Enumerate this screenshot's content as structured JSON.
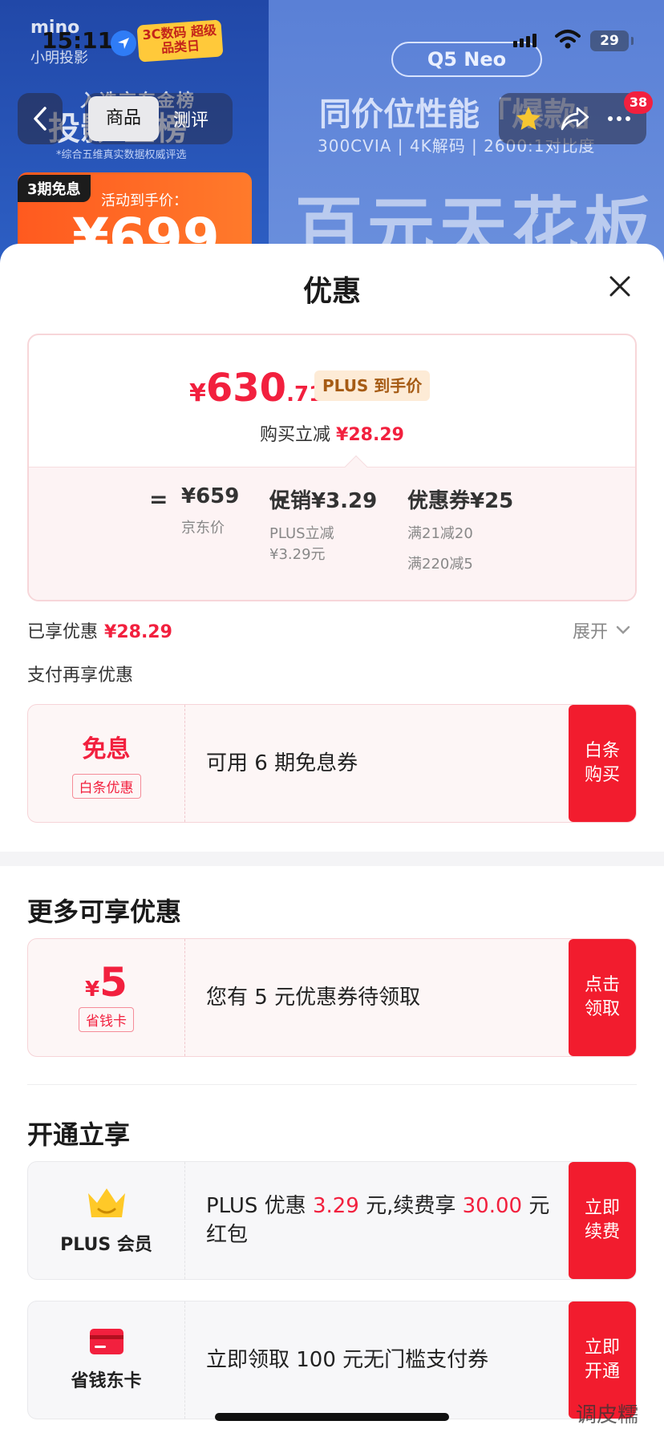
{
  "status_bar": {
    "time": "15:11",
    "battery": "29"
  },
  "background": {
    "brand": "mino",
    "brand_sub": "小明投影",
    "promo_tag": "3C数码 超级品类日",
    "rank_text": "入选京东金榜",
    "left_big": "投影 金榜",
    "left_small": "*综合五维真实数据权威评选",
    "installment_tag": "3期免息",
    "installment_label": "活动到手价：",
    "installment_price": "¥699",
    "model": "Q5 Neo",
    "headline": "同价位性能「爆款」",
    "specs": "300CVIA | 4K解码 | 2600:1对比度",
    "huge": "百元天花板"
  },
  "nav": {
    "tab_active": "商品",
    "tab_other": "测评",
    "badge": "38"
  },
  "sheet": {
    "title": "优惠",
    "price": {
      "currency": "¥",
      "integer": "630",
      "decimal": ".71",
      "plus_tag": "PLUS 到手价",
      "instant_cut_label": "购买立减",
      "instant_cut_value": "¥28.29"
    },
    "calc": {
      "equals": "=",
      "minus": "−",
      "jd_price": "¥659",
      "jd_price_label": "京东价",
      "promo": "促销¥3.29",
      "promo_sub1": "PLUS立减",
      "promo_sub2": "¥3.29元",
      "coupon": "优惠券¥25",
      "coupon_sub1": "满21减20",
      "coupon_sub2": "满220减5"
    },
    "enjoyed_label": "已享优惠",
    "enjoyed_value": "¥28.29",
    "expand_label": "展开",
    "pay_more_label": "支付再享优惠",
    "baitiao": {
      "title": "免息",
      "tag": "白条优惠",
      "text": "可用 6 期免息券",
      "button": "白条\n购买"
    },
    "more_section_title": "更多可享优惠",
    "saving_card": {
      "currency": "¥",
      "amount": "5",
      "tag": "省钱卡",
      "text": "您有 5 元优惠券待领取",
      "button": "点击\n领取"
    },
    "open_section_title": "开通立享",
    "plus": {
      "label": "PLUS 会员",
      "text_a": "PLUS 优惠 ",
      "text_b": "3.29",
      "text_c": " 元,续费享 ",
      "text_d": "30.00",
      "text_e": " 元红包",
      "button": "立即\n续费"
    },
    "jd_card": {
      "label": "省钱东卡",
      "text": "立即领取 100 元无门槛支付券",
      "button": "立即\n开通"
    },
    "watermark": "调皮糯"
  },
  "colors": {
    "accent_red": "#f2203e",
    "button_red": "#f21c2e",
    "plus_gold": "#a65b14"
  }
}
